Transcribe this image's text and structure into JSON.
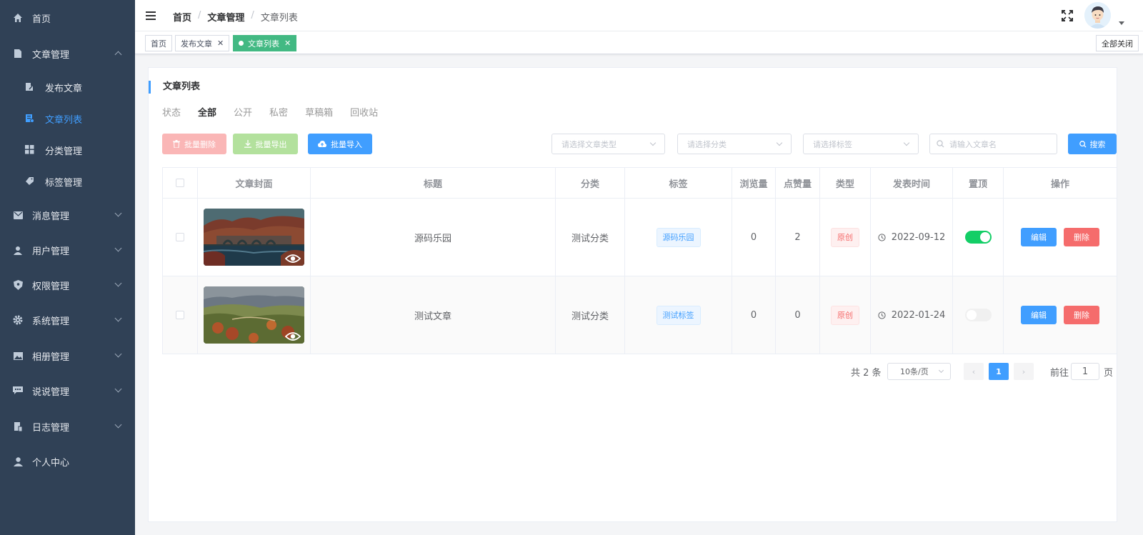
{
  "sidebar": {
    "items": [
      {
        "label": "首页",
        "icon": "home-icon"
      },
      {
        "label": "文章管理",
        "icon": "document-icon",
        "expanded": true,
        "children": [
          {
            "label": "发布文章",
            "icon": "edit-icon"
          },
          {
            "label": "文章列表",
            "icon": "list-icon",
            "active": true
          },
          {
            "label": "分类管理",
            "icon": "grid-icon"
          },
          {
            "label": "标签管理",
            "icon": "tag-icon"
          }
        ]
      },
      {
        "label": "消息管理",
        "icon": "mail-icon"
      },
      {
        "label": "用户管理",
        "icon": "user-icon"
      },
      {
        "label": "权限管理",
        "icon": "shield-icon"
      },
      {
        "label": "系统管理",
        "icon": "gear-icon"
      },
      {
        "label": "相册管理",
        "icon": "image-icon"
      },
      {
        "label": "说说管理",
        "icon": "chat-icon"
      },
      {
        "label": "日志管理",
        "icon": "log-icon"
      },
      {
        "label": "个人中心",
        "icon": "person-icon"
      }
    ]
  },
  "header": {
    "breadcrumb": [
      "首页",
      "文章管理",
      "文章列表"
    ]
  },
  "tags": {
    "items": [
      {
        "label": "首页"
      },
      {
        "label": "发布文章"
      },
      {
        "label": "文章列表",
        "active": true
      }
    ],
    "close_all": "全部关闭",
    "close_glyph": "✕"
  },
  "card": {
    "title": "文章列表",
    "status_label": "状态",
    "status_tabs": [
      "全部",
      "公开",
      "私密",
      "草稿箱",
      "回收站"
    ],
    "buttons": {
      "batch_delete": "批量删除",
      "batch_export": "批量导出",
      "batch_import": "批量导入",
      "search": "搜索"
    },
    "filters": {
      "type_placeholder": "请选择文章类型",
      "category_placeholder": "请选择分类",
      "tag_placeholder": "请选择标签",
      "name_placeholder": "请输入文章名"
    }
  },
  "table": {
    "columns": [
      "文章封面",
      "标题",
      "分类",
      "标签",
      "浏览量",
      "点赞量",
      "类型",
      "发表时间",
      "置顶",
      "操作"
    ],
    "rows": [
      {
        "title": "源码乐园",
        "category": "测试分类",
        "tag": "源码乐园",
        "views": "0",
        "likes": "2",
        "type": "原创",
        "date": "2022-09-12",
        "top": true
      },
      {
        "title": "测试文章",
        "category": "测试分类",
        "tag": "测试标签",
        "views": "0",
        "likes": "0",
        "type": "原创",
        "date": "2022-01-24",
        "top": false
      }
    ],
    "edit_label": "编辑",
    "delete_label": "删除"
  },
  "pagination": {
    "total": "共 2 条",
    "page_size": "10条/页",
    "current_page": "1",
    "goto_label": "前往",
    "goto_value": "1",
    "unit": "页",
    "prev_glyph": "‹",
    "next_glyph": "›"
  },
  "colors": {
    "sidebar_bg": "#304156",
    "primary": "#409eff",
    "success": "#42b983",
    "danger": "#f56c6c"
  }
}
